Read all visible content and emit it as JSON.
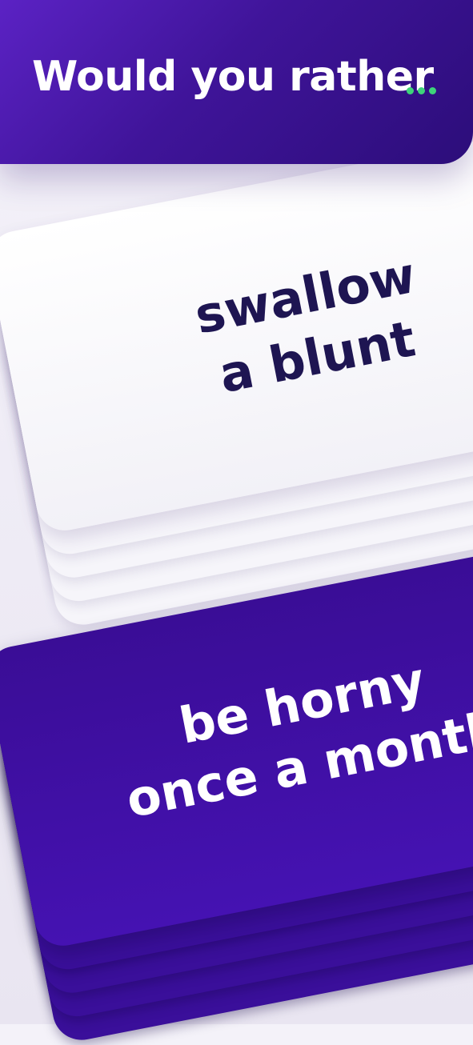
{
  "header": {
    "title": "Would you rather",
    "dots_color": "#3ed47a"
  },
  "cards": {
    "option_a": {
      "line1": "swallow",
      "line2": "a blunt"
    },
    "option_b": {
      "line1": "be horny",
      "line2": "once a month"
    }
  },
  "colors": {
    "header_purple": "#3f1499",
    "card_purple": "#4512b2",
    "card_white": "#ffffff",
    "dark_text": "#1e1552"
  }
}
